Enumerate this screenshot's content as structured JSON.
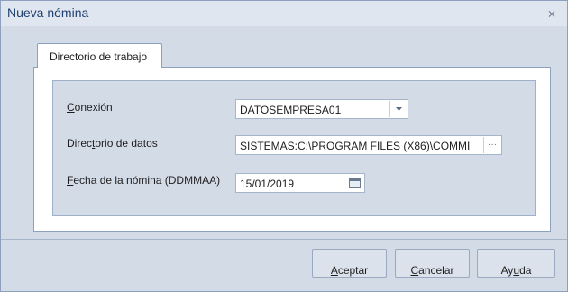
{
  "window": {
    "title": "Nueva nómina",
    "close_glyph": "⨯"
  },
  "tabs": [
    {
      "label": "Directorio de trabajo",
      "active": true
    }
  ],
  "form": {
    "connection": {
      "label_accel": "C",
      "label_rest": "onexión",
      "value": "DATOSEMPRESA01",
      "button_icon": "chevron-down-icon"
    },
    "data_directory": {
      "label_pre": "Direc",
      "label_accel": "t",
      "label_rest": "orio de datos",
      "value": "SISTEMAS:C:\\PROGRAM FILES (X86)\\COMMI",
      "button_icon": "ellipsis-icon",
      "button_text": "···"
    },
    "payroll_date": {
      "label_accel": "F",
      "label_rest": "echa de la nómina (DDMMAA)",
      "value": "15/01/2019",
      "button_icon": "calendar-icon"
    }
  },
  "buttons": {
    "accept": {
      "accel": "A",
      "rest": "ceptar"
    },
    "cancel": {
      "accel": "C",
      "rest": "ancelar"
    },
    "help": {
      "pre": "Ay",
      "accel": "u",
      "rest": "da"
    }
  },
  "colors": {
    "background": "#d3dbe7",
    "title_text": "#1f3f6e",
    "border": "#8da0bd"
  }
}
